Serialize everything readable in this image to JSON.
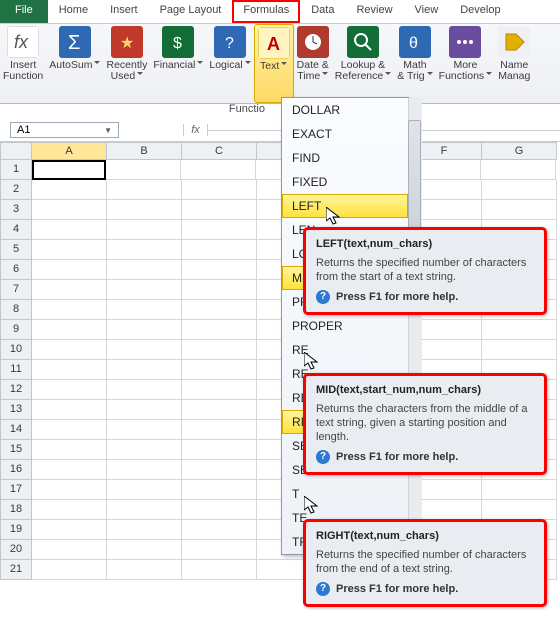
{
  "tabs": {
    "file": "File",
    "home": "Home",
    "insert": "Insert",
    "pagelayout": "Page Layout",
    "formulas": "Formulas",
    "data": "Data",
    "review": "Review",
    "view": "View",
    "develop": "Develop"
  },
  "ribbon": {
    "insertfn": "Insert\nFunction",
    "autosum": "AutoSum",
    "recently": "Recently\nUsed",
    "financial": "Financial",
    "logical": "Logical",
    "text": "Text",
    "datetime": "Date &\nTime",
    "lookup": "Lookup &\nReference",
    "math": "Math\n& Trig",
    "more": "More\nFunctions",
    "name": "Name\nManag"
  },
  "funcgroup": "Functio",
  "namebox": "A1",
  "fx": "fx",
  "cols": [
    "A",
    "B",
    "C",
    "",
    "",
    "F",
    "G"
  ],
  "rows": [
    "1",
    "2",
    "3",
    "4",
    "5",
    "6",
    "7",
    "8",
    "9",
    "10",
    "11",
    "12",
    "13",
    "14",
    "15",
    "16",
    "17",
    "18",
    "19",
    "20",
    "21"
  ],
  "dropdown": {
    "items": [
      "DOLLAR",
      "EXACT",
      "FIND",
      "FIXED",
      "LEFT",
      "LEN",
      "LOWER",
      "MID",
      "PROPE",
      "PROPER",
      "RE",
      "RE",
      "REPLAC",
      "RIGHT",
      "SE",
      "SEARCH",
      "T",
      "TE",
      "TR"
    ],
    "hl": [
      4,
      7,
      13
    ]
  },
  "tips": {
    "left": {
      "sig": "LEFT(text,num_chars)",
      "body": "Returns the specified number of characters from the start of a text string.",
      "help": "Press F1 for more help."
    },
    "mid": {
      "sig": "MID(text,start_num,num_chars)",
      "body": "Returns the characters from the middle of a text string, given a starting position and length.",
      "help": "Press F1 for more help."
    },
    "right": {
      "sig": "RIGHT(text,num_chars)",
      "body": "Returns the specified number of characters from the end of a text string.",
      "help": "Press F1 for more help."
    }
  },
  "helpglyph": "?"
}
